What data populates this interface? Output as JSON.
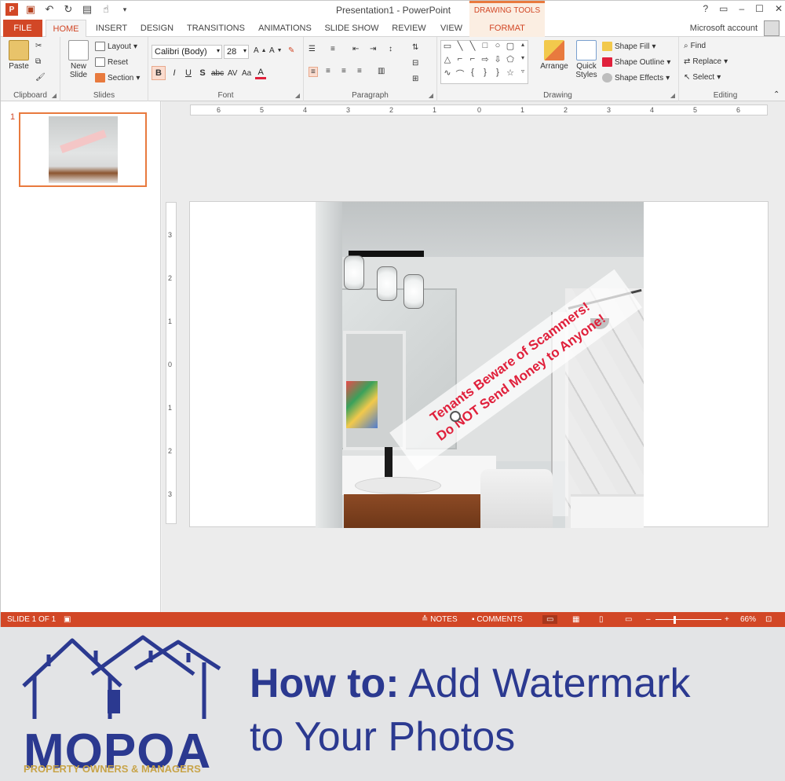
{
  "window": {
    "title": "Presentation1 - PowerPoint",
    "context_tools": "DRAWING TOOLS",
    "account": "Microsoft account",
    "controls": [
      "?",
      "▭",
      "–",
      "☐",
      "✕"
    ]
  },
  "tabs": [
    "FILE",
    "HOME",
    "INSERT",
    "DESIGN",
    "TRANSITIONS",
    "ANIMATIONS",
    "SLIDE SHOW",
    "REVIEW",
    "VIEW",
    "FORMAT"
  ],
  "ribbon": {
    "clipboard": {
      "label": "Clipboard",
      "paste": "Paste"
    },
    "slides": {
      "label": "Slides",
      "new_slide": "New",
      "new_slide2": "Slide",
      "layout": "Layout",
      "reset": "Reset",
      "section": "Section"
    },
    "font": {
      "label": "Font",
      "name": "Calibri (Body)",
      "size": "28",
      "bold": "B",
      "italic": "I",
      "underline": "U",
      "shadow": "S",
      "strike": "abc",
      "spacing": "AV",
      "case": "Aa",
      "color": "A"
    },
    "paragraph": {
      "label": "Paragraph"
    },
    "drawing": {
      "label": "Drawing",
      "arrange": "Arrange",
      "quick": "Quick",
      "styles": "Styles",
      "fill": "Shape Fill",
      "outline": "Shape Outline",
      "effects": "Shape Effects"
    },
    "editing": {
      "label": "Editing",
      "find": "Find",
      "replace": "Replace",
      "select": "Select"
    }
  },
  "thumbnails": {
    "slide_number": "1"
  },
  "ruler": {
    "h": [
      "6",
      "5",
      "4",
      "3",
      "2",
      "1",
      "0",
      "1",
      "2",
      "3",
      "4",
      "5",
      "6"
    ],
    "v": [
      "3",
      "2",
      "1",
      "0",
      "1",
      "2",
      "3"
    ]
  },
  "slide": {
    "watermark_line1": "Tenants Beware of Scammers!",
    "watermark_line2": "Do NOT Send Money to Anyone!"
  },
  "status": {
    "slide_info": "SLIDE 1 OF 1",
    "notes": "NOTES",
    "comments": "COMMENTS",
    "zoom": "66%"
  },
  "banner": {
    "logo_name": "MOPOA",
    "logo_sub": "PROPERTY OWNERS & MANAGERS",
    "headline_bold": "How to:",
    "headline_rest": " Add Watermark",
    "headline_line2": "to Your Photos"
  },
  "colors": {
    "accent": "#d24726",
    "brand": "#2b3990",
    "watermark": "#e0203b",
    "logo_gold": "#c8a449"
  }
}
